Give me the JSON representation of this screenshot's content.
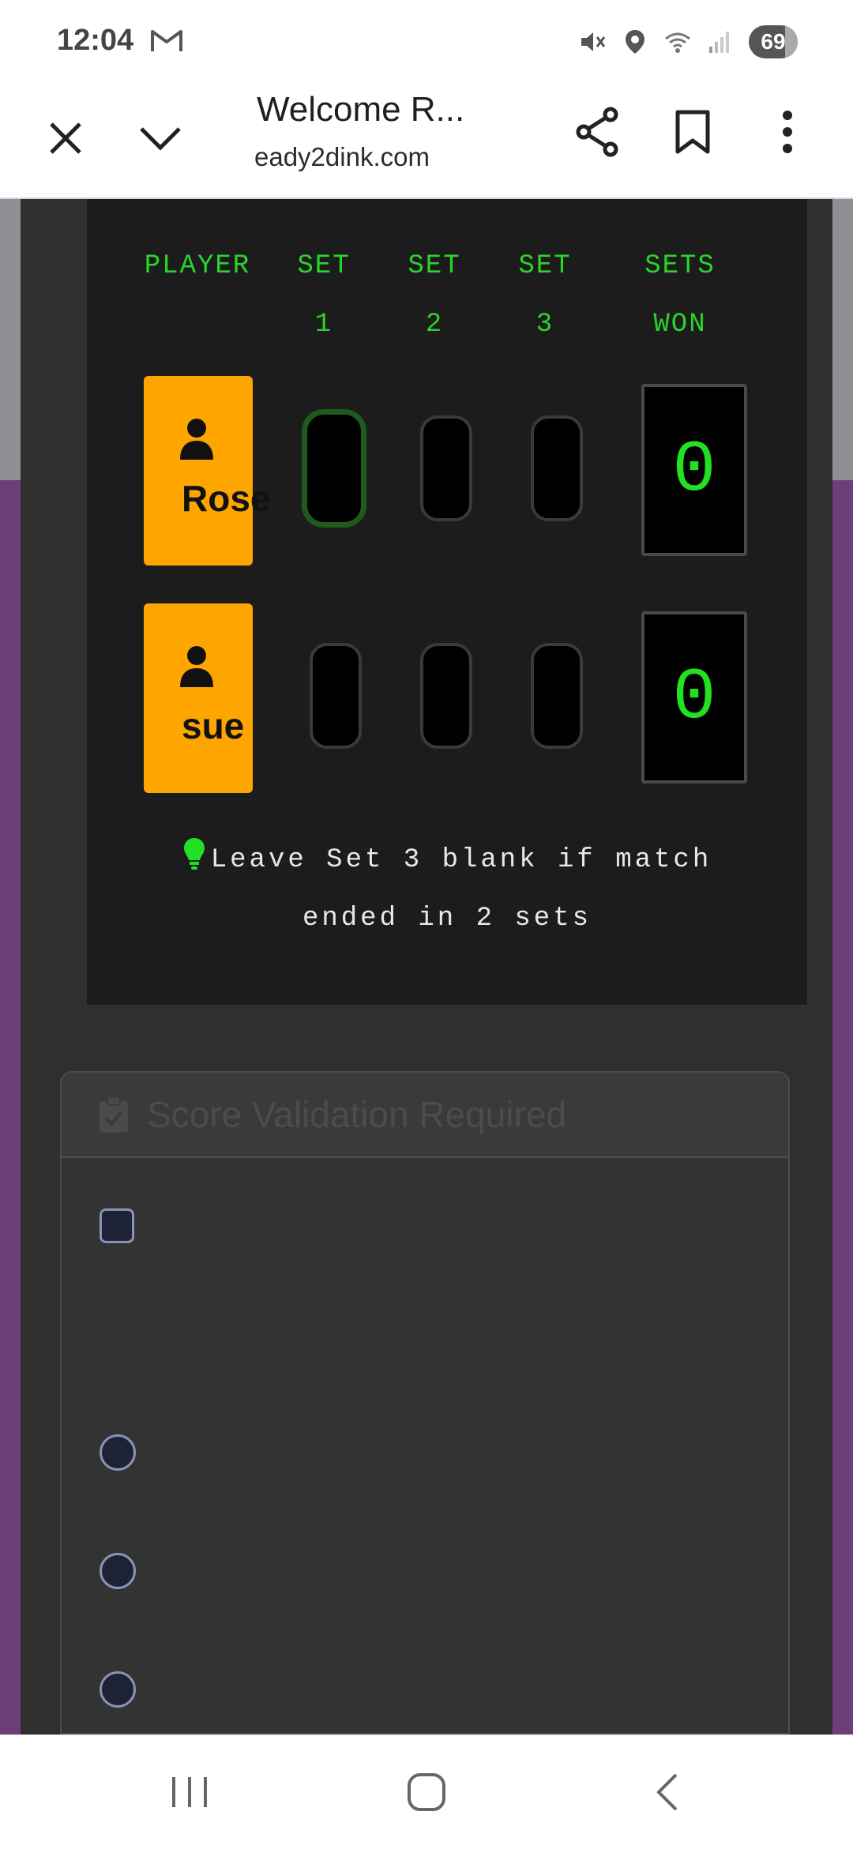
{
  "status_bar": {
    "time": "12:04",
    "battery": "69",
    "icons": [
      "gmail-icon",
      "mute-icon",
      "location-icon",
      "wifi-icon",
      "signal-icon"
    ]
  },
  "browser": {
    "title": "Welcome R...",
    "url": "eady2dink.com",
    "icons": [
      "close-icon",
      "chevron-down-icon",
      "share-icon",
      "bookmark-icon",
      "more-vert-icon"
    ]
  },
  "score_table": {
    "headers": [
      {
        "line1": "PLAYER",
        "line2": ""
      },
      {
        "line1": "SET",
        "line2": "1"
      },
      {
        "line1": "SET",
        "line2": "2"
      },
      {
        "line1": "SET",
        "line2": "3"
      },
      {
        "line1": "SETS",
        "line2": "WON"
      }
    ],
    "players": [
      {
        "name": "Rose",
        "sets": [
          "",
          "",
          ""
        ],
        "sets_won": "0"
      },
      {
        "name": "sue",
        "sets": [
          "",
          "",
          ""
        ],
        "sets_won": "0"
      }
    ],
    "hint_line1": "Leave Set 3 blank if match",
    "hint_line2": "ended in 2 sets"
  },
  "validation": {
    "title": "Score Validation Required"
  },
  "colors": {
    "accent_green": "#22e022",
    "player_card": "#ffa500",
    "page_purple": "#6d3f7a"
  }
}
